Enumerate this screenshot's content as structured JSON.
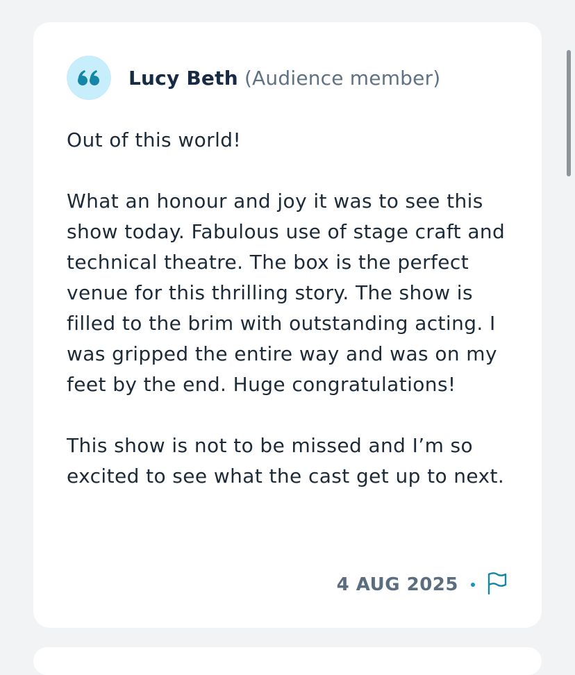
{
  "review": {
    "author_name": "Lucy Beth",
    "author_role": "(Audience member)",
    "paragraphs": [
      "Out of this world!",
      "What an honour and joy it was to see this show today. Fabulous use of stage craft and technical theatre. The box is the perfect venue for this thrilling story. The show is filled to the brim with outstanding acting. I was gripped the entire way and was on my feet by the end. Huge congratulations!",
      "This show is not to be missed and I’m so excited to see what the cast get up to next."
    ],
    "date": "4 AUG 2025"
  },
  "icons": {
    "quote": "quote-icon",
    "flag": "flag-icon"
  },
  "colors": {
    "page_background": "#f2f3f5",
    "card_background": "#ffffff",
    "quote_badge": "#c9eefb",
    "quote_glyph": "#1686a8",
    "text_primary": "#1d2a38",
    "text_secondary": "#5e7185",
    "accent": "#1596b8"
  }
}
